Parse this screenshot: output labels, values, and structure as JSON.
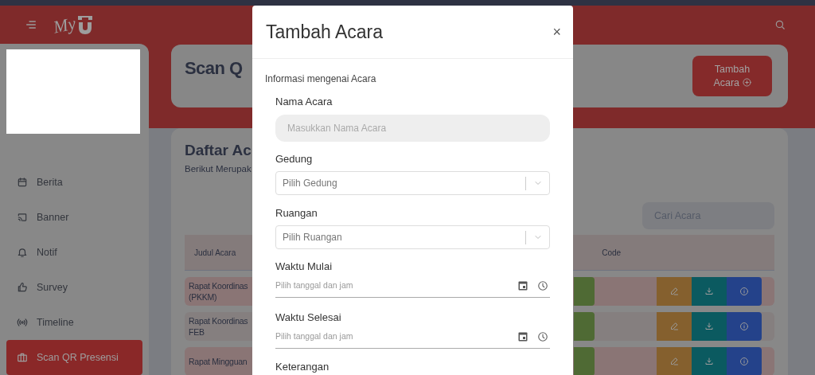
{
  "header": {
    "logo_text": "My"
  },
  "sidebar": {
    "items": [
      {
        "label": "Berita",
        "selected": false
      },
      {
        "label": "Banner",
        "selected": false
      },
      {
        "label": "Notif",
        "selected": false
      },
      {
        "label": "Survey",
        "selected": false
      },
      {
        "label": "Timeline",
        "selected": false
      },
      {
        "label": "Scan QR Presensi",
        "selected": true
      }
    ]
  },
  "page": {
    "title": "Scan Q",
    "add_button": "Tambah Acara"
  },
  "events": {
    "title": "Daftar Ac",
    "subtitle": "Berikut Merupak",
    "search": {
      "placeholder": "Cari Acara"
    },
    "table": {
      "columns": [
        "Judul Acara",
        "Code"
      ],
      "rows": [
        {
          "title": "Rapat Koordinas (PKKM)"
        },
        {
          "title": "Rapat Koordinas FEB"
        },
        {
          "title": "Rapat Mingguan"
        }
      ]
    }
  },
  "modal": {
    "title": "Tambah Acara",
    "close": "×",
    "section_label": "Informasi mengenai Acara",
    "fields": [
      {
        "kind": "text",
        "label": "Nama Acara",
        "placeholder": "Masukkan Nama Acara"
      },
      {
        "kind": "select",
        "label": "Gedung",
        "placeholder": "Pilih Gedung"
      },
      {
        "kind": "select",
        "label": "Ruangan",
        "placeholder": "Pilih Ruangan"
      },
      {
        "kind": "datetime",
        "label": "Waktu Mulai",
        "placeholder": "Pilih tanggal dan jam"
      },
      {
        "kind": "datetime",
        "label": "Waktu Selesai",
        "placeholder": "Pilih tanggal dan jam"
      },
      {
        "kind": "textarea",
        "label": "Keterangan"
      }
    ]
  }
}
